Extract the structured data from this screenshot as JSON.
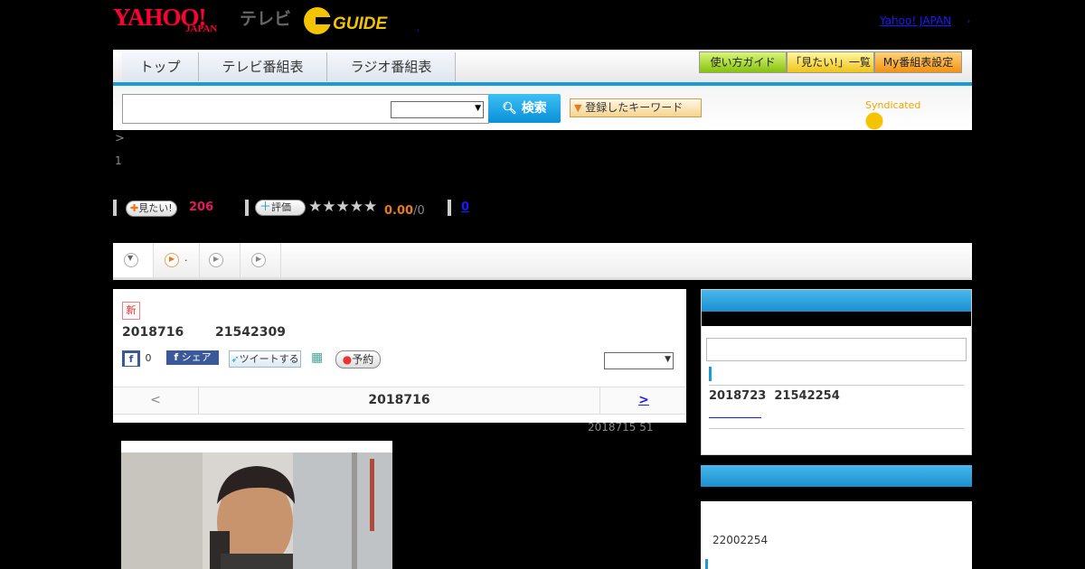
{
  "header": {
    "logo_yahoo": "YAHOO!",
    "logo_japan": "JAPAN",
    "logo_tv": "テレビ",
    "logo_g": "GUIDE",
    "yahoo_japan_link": "Yahoo! JAPAN",
    "separator": ",",
    "dot": ","
  },
  "nav": {
    "tabs": [
      "トップ",
      "テレビ番組表",
      "ラジオ番組表"
    ],
    "guides": [
      "使い方ガイド",
      "「見たい!」一覧",
      "My番組表設定"
    ]
  },
  "search": {
    "button_label": "検索",
    "keywords_label": "登録したキーワード",
    "syndicated": "Syndicated"
  },
  "breadcrumb": {
    "arrow": ">",
    "number": "1"
  },
  "stats": {
    "want_label": "見たい!",
    "want_count": "206",
    "rate_label": "評価",
    "stars": [
      "★",
      "★",
      "★",
      "★",
      "★"
    ],
    "rating": "0.00",
    "rating_suffix": "/0",
    "reviews_link": "0"
  },
  "tabs": {
    "second_label": "."
  },
  "episode": {
    "new_badge": "新",
    "date": "2018716",
    "time": "21542309",
    "fb_count": "0",
    "fb_share": "シェア",
    "tweet": "ツイートする",
    "reserve": "予約",
    "pager_prev": "<",
    "pager_mid": "2018716",
    "pager_next": ">",
    "updated": "2018715  51"
  },
  "sidebar": {
    "next_date": "2018723",
    "next_time": "21542254",
    "bottom_time": "22002254"
  }
}
